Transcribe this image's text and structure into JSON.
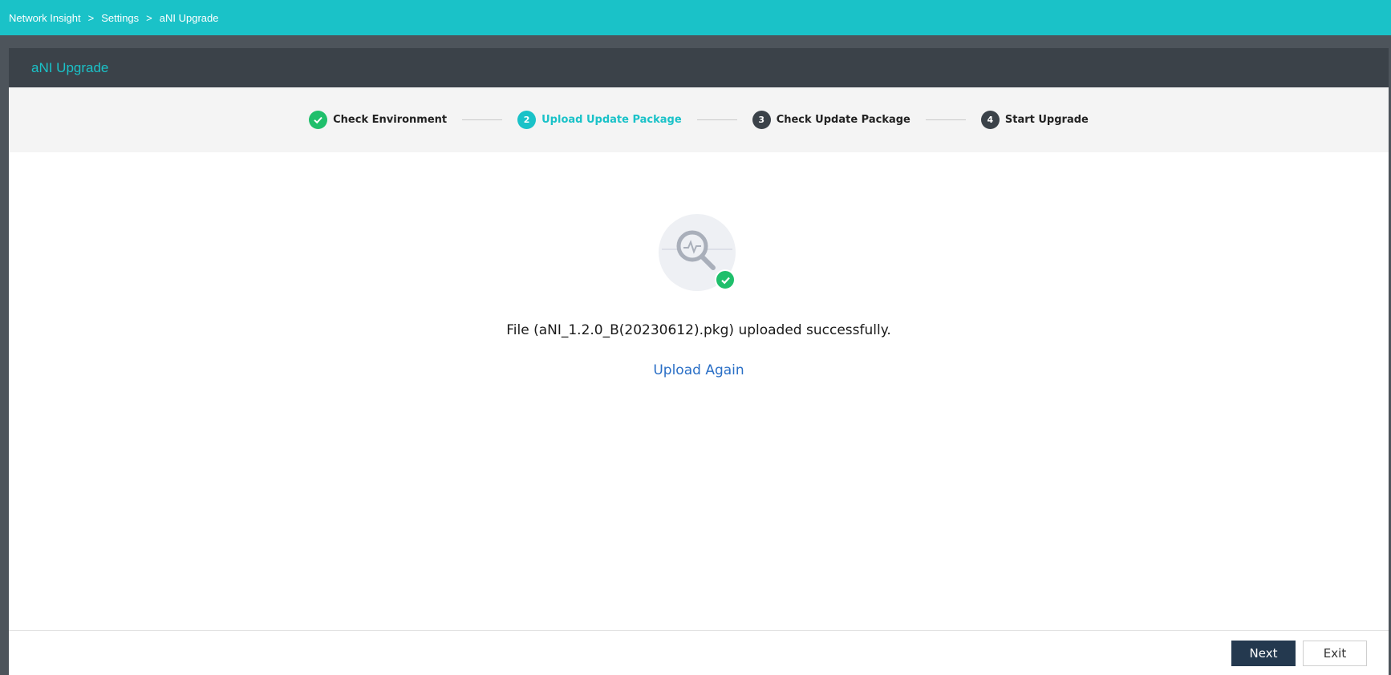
{
  "breadcrumb": {
    "items": [
      "Network Insight",
      "Settings",
      "aNI Upgrade"
    ],
    "separator": ">"
  },
  "panel": {
    "title": "aNI Upgrade"
  },
  "steps": [
    {
      "number": "1",
      "label": "Check Environment",
      "state": "done"
    },
    {
      "number": "2",
      "label": "Upload Update Package",
      "state": "active"
    },
    {
      "number": "3",
      "label": "Check Update Package",
      "state": "pending"
    },
    {
      "number": "4",
      "label": "Start Upgrade",
      "state": "pending"
    }
  ],
  "result": {
    "icon": "search-success-icon",
    "message": "File (aNI_1.2.0_B(20230612).pkg) uploaded successfully.",
    "upload_again_label": "Upload Again"
  },
  "footer": {
    "next_label": "Next",
    "exit_label": "Exit"
  },
  "colors": {
    "accent": "#1ac2c8",
    "success": "#1fbf6b",
    "header_dark": "#3b4249",
    "primary_button": "#24394f",
    "link": "#2a6fc6"
  }
}
